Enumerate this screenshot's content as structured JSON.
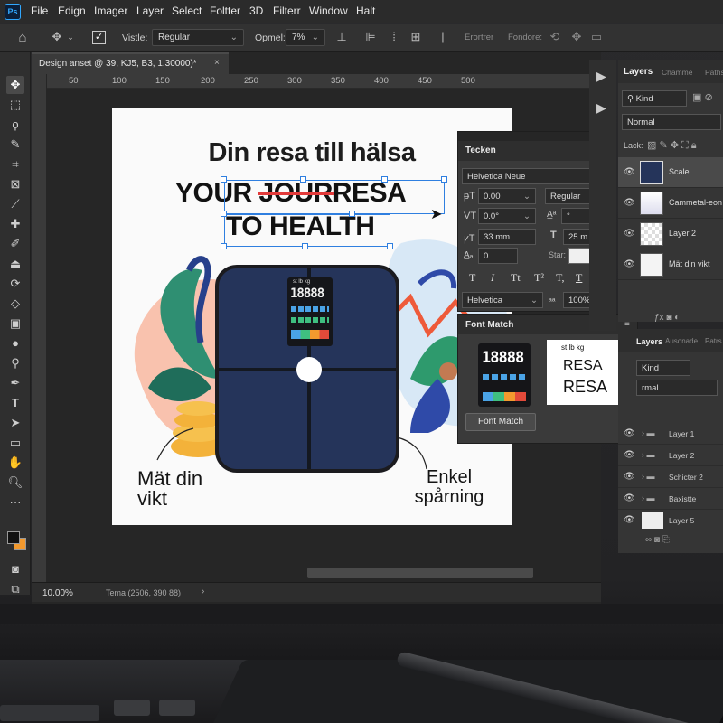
{
  "app": {
    "logo": "Ps"
  },
  "menu": [
    "File",
    "Edign",
    "Imager",
    "Layer",
    "Select",
    "Foltter",
    "3D",
    "Filterr",
    "Window",
    "Halt"
  ],
  "options": {
    "vistle_label": "Vistle:",
    "vistle_value": "Regular",
    "opmel_label": "Opmel:",
    "opmel_value": "7%",
    "erortrer_label": "Erortrer",
    "fondore_label": "Fondore:"
  },
  "document": {
    "tab_title": "Design anset @ 39, KJ5, B3, 1.30000)*",
    "zoom": "10.00%",
    "status": "Tema (2506, 390 88)"
  },
  "ruler": {
    "ticks": [
      "50",
      "100",
      "150",
      "200",
      "250",
      "300",
      "350",
      "400",
      "450",
      "500"
    ]
  },
  "design": {
    "headline": "Din resa till hälsa",
    "line1_a": "YOUR",
    "line1_struck": "JOUR",
    "line1_b": "RESA",
    "line2": "TO HEALTH",
    "left_label_1": "Mät din",
    "left_label_2": "vikt",
    "right_label_1": "Enkel",
    "right_label_2": "spårning",
    "scale_display": "18888",
    "scale_units": [
      "st",
      "lb",
      "kg"
    ]
  },
  "tecken_panel": {
    "title": "Tecken",
    "font_family": "Helvetica Neue",
    "tracking": "0.00",
    "style": "Regular",
    "vscale": "0.0°",
    "baseline": "°",
    "size": "33 mm",
    "leading": "25 m",
    "kerning": "0",
    "star_label": "Star:",
    "type_buttons": [
      "T",
      "I",
      "Tt",
      "T²",
      "T,",
      "T",
      "Tₗ"
    ],
    "font2": "Helvetica",
    "scale_pct": "100%"
  },
  "font_match": {
    "title": "Font Match",
    "preview_units": "st lb kg",
    "preview_line1": "RESA",
    "preview_line2": "RESA",
    "button": "Font Match",
    "scale_display": "18888"
  },
  "layers_panel": {
    "tabs": [
      "Layers",
      "Chamme",
      "Paths"
    ],
    "filter": "Kind",
    "blend": "Normal",
    "lock_label": "Lack:",
    "layers": [
      "Scale",
      "Cammetal-eon li",
      "Layer 2",
      "Mät din vikt"
    ]
  },
  "layers_panel2": {
    "tabs": [
      "Layers",
      "Ausonade",
      "Patrs"
    ],
    "filter": "Kind",
    "blend": "rmal",
    "groups": [
      "Layer 1",
      "Layer 2",
      "Schicter 2",
      "Baxistte",
      "Layer 5"
    ]
  },
  "colors": {
    "accent": "#31a8ff",
    "scale_body": "#25345a",
    "strike": "#e23a3a",
    "foreground": "#111111",
    "background": "#f2992e"
  }
}
